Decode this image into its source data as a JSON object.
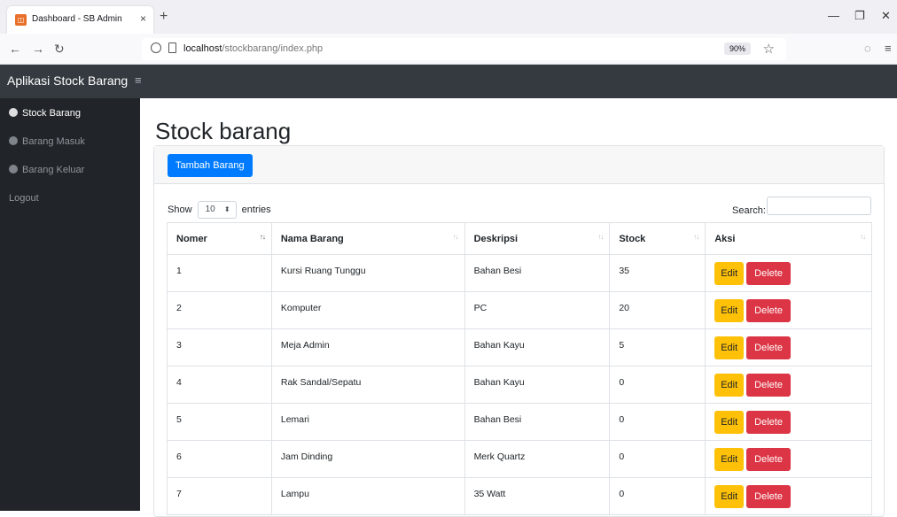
{
  "browser": {
    "tab_title": "Dashboard - SB Admin",
    "tab_close": "×",
    "new_tab": "+",
    "url_host": "localhost",
    "url_path": "/stockbarang/index.php",
    "zoom": "90%"
  },
  "app": {
    "brand": "Aplikasi Stock Barang",
    "sidebar": [
      {
        "label": "Stock Barang",
        "active": true
      },
      {
        "label": "Barang Masuk",
        "active": false
      },
      {
        "label": "Barang Keluar",
        "active": false
      },
      {
        "label": "Logout",
        "active": false
      }
    ],
    "page_title": "Stock barang",
    "add_button": "Tambah Barang"
  },
  "datatable": {
    "show_label": "Show",
    "entries_value": "10",
    "entries_label": "entries",
    "search_label": "Search:",
    "columns": [
      "Nomer",
      "Nama Barang",
      "Deskripsi",
      "Stock",
      "Aksi"
    ],
    "rows": [
      {
        "no": "1",
        "nama": "Kursi Ruang Tunggu",
        "deskripsi": "Bahan Besi",
        "stock": "35"
      },
      {
        "no": "2",
        "nama": "Komputer",
        "deskripsi": "PC",
        "stock": "20"
      },
      {
        "no": "3",
        "nama": "Meja Admin",
        "deskripsi": "Bahan Kayu",
        "stock": "5"
      },
      {
        "no": "4",
        "nama": "Rak Sandal/Sepatu",
        "deskripsi": "Bahan Kayu",
        "stock": "0"
      },
      {
        "no": "5",
        "nama": "Lemari",
        "deskripsi": "Bahan Besi",
        "stock": "0"
      },
      {
        "no": "6",
        "nama": "Jam Dinding",
        "deskripsi": "Merk Quartz",
        "stock": "0"
      },
      {
        "no": "7",
        "nama": "Lampu",
        "deskripsi": "35 Watt",
        "stock": "0"
      }
    ],
    "edit_label": "Edit",
    "delete_label": "Delete"
  },
  "colors": {
    "topnav": "#343a40",
    "sidebar": "#212529",
    "primary": "#007bff",
    "warning": "#ffc107",
    "danger": "#dc3545"
  }
}
